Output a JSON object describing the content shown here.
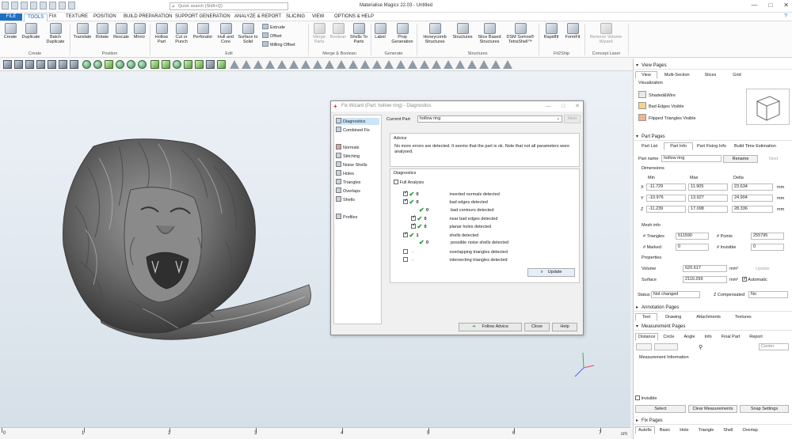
{
  "app": {
    "window_title": "Materialise Magics 22.03 - Untitled",
    "search_placeholder": "Quick search (Shift+Q)",
    "window_controls": [
      "—",
      "□",
      "✕"
    ],
    "help_icon": "?"
  },
  "menu": [
    "FILE",
    "TOOLS",
    "FIX",
    "TEXTURE",
    "POSITION",
    "BUILD PREPARATION",
    "SUPPORT GENERATION",
    "ANALYZE & REPORT",
    "SLICING",
    "VIEW",
    "OPTIONS & HELP"
  ],
  "ribbon": {
    "create": {
      "create": "Create",
      "duplicate": "Duplicate",
      "batch": "Batch Duplicate",
      "group": "Create"
    },
    "position": {
      "translate": "Translate",
      "rotate": "Rotate",
      "rescale": "Rescale",
      "mirror": "Mirror",
      "group": "Position"
    },
    "edit": {
      "hollow": "Hollow Part",
      "cut": "Cut or Punch",
      "perforator": "Perforator",
      "hull": "Hull and Core",
      "surface": "Surface to Solid",
      "extrude": "Extrude",
      "offset": "Offset",
      "milling": "Milling Offset",
      "group": "Edit"
    },
    "merge": {
      "merge_parts": "Merge Parts",
      "boolean": "Boolean",
      "shells": "Shells To Parts",
      "group": "Merge & Boolean"
    },
    "generate": {
      "label": "Label",
      "prop": "Prop Generation",
      "group": "Generate"
    },
    "structures": {
      "honeycomb": "Honeycomb Structures",
      "structures": "Structures",
      "slice": "Slice Based Structures",
      "dsm": "DSM Somos® TetraShell™",
      "group": "Structures"
    },
    "fit": {
      "rapidfit": "Rapidfit",
      "formfit": "FormFit",
      "group": "Fit2Ship"
    },
    "laser": {
      "remove": "Remove Volume Wizard",
      "group": "Concept Laser"
    }
  },
  "ruler": {
    "ticks": [
      "0",
      "1",
      "2",
      "3",
      "4",
      "5",
      "6",
      "7"
    ],
    "unit": "cm"
  },
  "dialog": {
    "title": "Fix Wizard (Part: hollow ring) - Diagnostics",
    "nav": [
      "Diagnostics",
      "Combined Fix",
      "Normals",
      "Stitching",
      "Noise Shells",
      "Holes",
      "Triangles",
      "Overlaps",
      "Shells",
      "Profiles"
    ],
    "current_part_label": "Current Part",
    "current_part": "hollow ring",
    "next_label": "Next",
    "advice_heading": "Advice",
    "advice_text": "No more errors are detected. It seems that the part is ok. Note that not all parameters were analysed.",
    "diagnostics_heading": "Diagnostics",
    "full_analysis": "Full Analysis",
    "rows": [
      {
        "count": "0",
        "label": "inverted normals detected"
      },
      {
        "count": "0",
        "label": "bad edges detected"
      },
      {
        "count": "0",
        "label": "bad contours detected"
      },
      {
        "count": "0",
        "label": "near bad edges detected"
      },
      {
        "count": "0",
        "label": "planar holes detected"
      },
      {
        "count": "1",
        "label": "shells detected"
      },
      {
        "count": "0",
        "label": "possible noise shells detected"
      },
      {
        "count": "-",
        "label": "overlapping triangles detected"
      },
      {
        "count": "-",
        "label": "intersecting triangles detected"
      }
    ],
    "update": "Update",
    "follow_advice": "Follow Advice",
    "close": "Close",
    "help": "Help"
  },
  "view_pages": {
    "title": "View Pages",
    "tabs": [
      "View",
      "Multi-Section",
      "Slices",
      "Grid"
    ],
    "visualization": "Visualization",
    "items": [
      "Shaded&Wire",
      "Bad Edges Visible",
      "Flipped Triangles Visible"
    ]
  },
  "part_pages": {
    "title": "Part Pages",
    "tabs": [
      "Part List",
      "Part Info",
      "Part Fixing Info",
      "Build Time Estimation"
    ],
    "part_name_label": "Part name",
    "part_name": "hollow ring",
    "rename": "Rename",
    "next": "Next",
    "dimensions": "Dimensions",
    "dim_headers": [
      "Min",
      "Max",
      "Delta"
    ],
    "dims": [
      {
        "axis": "X",
        "min": "-11.729",
        "max": "11.905",
        "delta": "23.634",
        "unit": "mm"
      },
      {
        "axis": "Y",
        "min": "-10.976",
        "max": "13.927",
        "delta": "24.904",
        "unit": "mm"
      },
      {
        "axis": "Z",
        "min": "-11.239",
        "max": "17.098",
        "delta": "28.336",
        "unit": "mm"
      }
    ],
    "mesh_info": "Mesh info",
    "triangles_label": "# Triangles",
    "triangles": "511590",
    "points_label": "# Points",
    "points": "255795",
    "marked_label": "# Marked",
    "marked": "0",
    "invisible_label": "# Invisible",
    "invisible": "0",
    "properties": "Properties",
    "volume_label": "Volume",
    "volume": "620.617",
    "volume_unit": "mm³",
    "update": "Update",
    "surface_label": "Surface",
    "surface": "2110.299",
    "surface_unit": "mm²",
    "automatic": "Automatic",
    "status_label": "Status",
    "status": "Not changed",
    "zcomp_label": "Z Compensated",
    "zcomp": "No"
  },
  "annotation_pages": {
    "title": "Annotation Pages",
    "tabs": [
      "Text",
      "Drawing",
      "Attachments",
      "Textures"
    ]
  },
  "measurement_pages": {
    "title": "Measurement Pages",
    "tabs": [
      "Distance",
      "Circle",
      "Angle",
      "Info",
      "Final Part",
      "Report"
    ],
    "center": "Center",
    "info": "Measurement Information",
    "invisible": "Invisible",
    "select": "Select",
    "clear": "Clear Measurements",
    "snap": "Snap Settings"
  },
  "fix_pages": {
    "title": "Fix Pages",
    "tabs": [
      "Autofix",
      "Basic",
      "Hole",
      "Triangle",
      "Shell",
      "Overlap"
    ]
  },
  "colors": {
    "accent": "#1e6fc2",
    "viewport_bg": "#e4ebf2",
    "check_green": "#1e9a34"
  }
}
